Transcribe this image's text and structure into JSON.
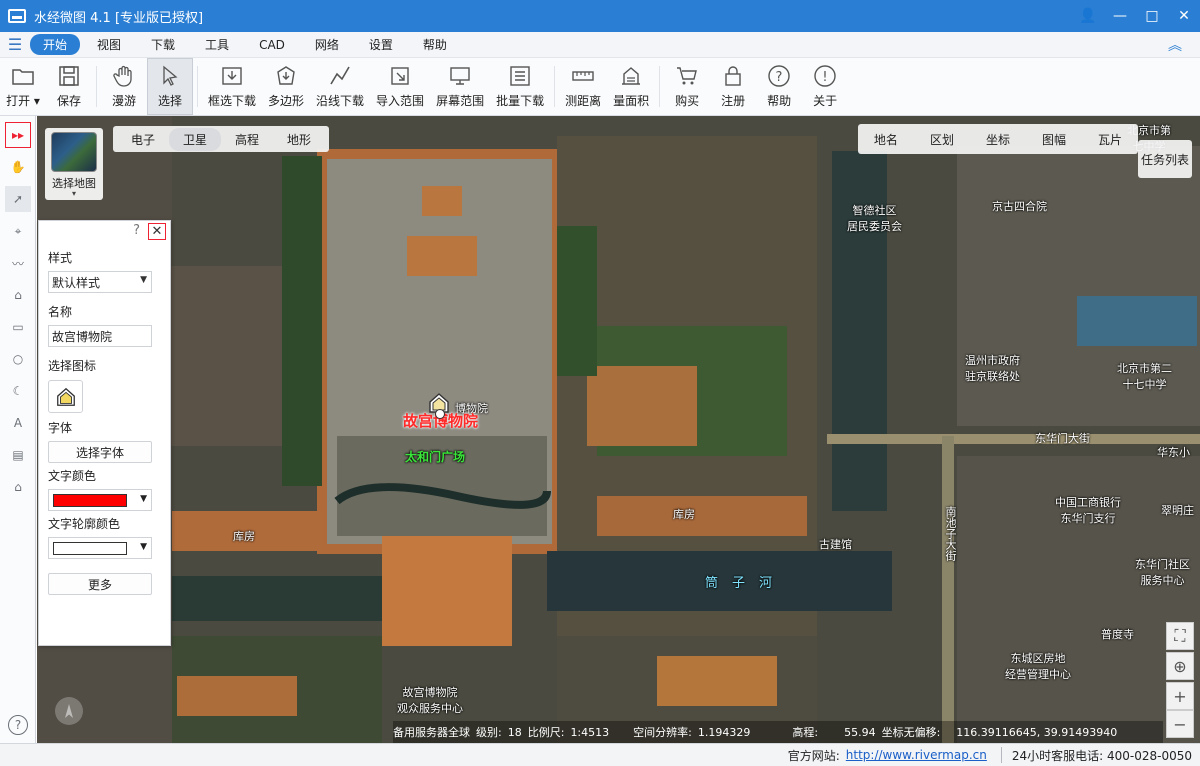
{
  "app": {
    "title": "水经微图 4.1 [专业版已授权]"
  },
  "window_buttons": [
    "👤",
    "—",
    "□",
    "✕"
  ],
  "menu": {
    "items": [
      {
        "label": "开始",
        "active": true
      },
      {
        "label": "视图"
      },
      {
        "label": "下载"
      },
      {
        "label": "工具"
      },
      {
        "label": "CAD"
      },
      {
        "label": "网络"
      },
      {
        "label": "设置"
      },
      {
        "label": "帮助"
      }
    ]
  },
  "toolbar": {
    "open": "打开",
    "save": "保存",
    "pan": "漫游",
    "select": "选择",
    "rect_download": "框选下载",
    "polygon": "多边形",
    "line_download": "沿线下载",
    "import_range": "导入范围",
    "screen_range": "屏幕范围",
    "batch_download": "批量下载",
    "measure_distance": "测距离",
    "measure_area": "量面积",
    "buy": "购买",
    "register": "注册",
    "help": "帮助",
    "about": "关于"
  },
  "map": {
    "type_tabs": [
      {
        "label": "电子"
      },
      {
        "label": "卫星",
        "active": true
      },
      {
        "label": "高程"
      },
      {
        "label": "地形"
      }
    ],
    "choose_map": "选择地图",
    "layers": [
      "地名",
      "区划",
      "坐标",
      "图幅",
      "瓦片"
    ],
    "task_list": "任务列表",
    "labels": {
      "palace_main": "故宫博物院",
      "palace_small": "博物院",
      "taihemen": "太和门广场",
      "zhizhi": "智德社区\n居民委员会",
      "jingsi": "京古四合院",
      "donghuamen": "东华门大街",
      "nanchizi": "南池子大街",
      "wenzhou": "温州市政府\n驻京联络处",
      "beijing_school": "北京市第二\n十七中学",
      "huaxiao": "华东小",
      "icbc": "中国工商银行\n东华门支行",
      "cuiming": "翠明庄",
      "donghuamen_community": "东华门社区\n服务中心",
      "kufang_right": "库房",
      "kufang_left": "库房",
      "gujianguan": "古建馆",
      "tongzi": "筒子河",
      "puduisi": "普度寺",
      "dongcheng_housing": "东城区房地\n经营管理中心",
      "audience_center": "故宫博物院\n观众服务中心",
      "beijing_school_top": "北京市第\n七中学"
    }
  },
  "style_panel": {
    "help_icon": "?",
    "close_icon": "✕",
    "style_label": "样式",
    "style_value": "默认样式",
    "name_label": "名称",
    "name_value": "故宫博物院",
    "icon_label": "选择图标",
    "font_label": "字体",
    "font_button": "选择字体",
    "text_color_label": "文字颜色",
    "text_color": "#ff0000",
    "outline_color_label": "文字轮廓颜色",
    "outline_color": "#ffffff",
    "more_button": "更多"
  },
  "map_status": {
    "server": "备用服务器全球",
    "level_label": "级别:",
    "level": "18",
    "scale_label": "比例尺:",
    "scale": "1:4513",
    "resolution_label": "空间分辨率:",
    "resolution": "1.194329",
    "elevation_label": "高程:",
    "elevation": "55.94",
    "coord_label": "坐标无偏移:",
    "coord": "116.39116645, 39.91493940"
  },
  "statusbar": {
    "website_label": "官方网站:",
    "website": "http://www.rivermap.cn",
    "phone": "24小时客服电话: 400-028-0050"
  },
  "colors": {
    "accent": "#2a7fd4",
    "poi_text": "#ff2a2a"
  }
}
